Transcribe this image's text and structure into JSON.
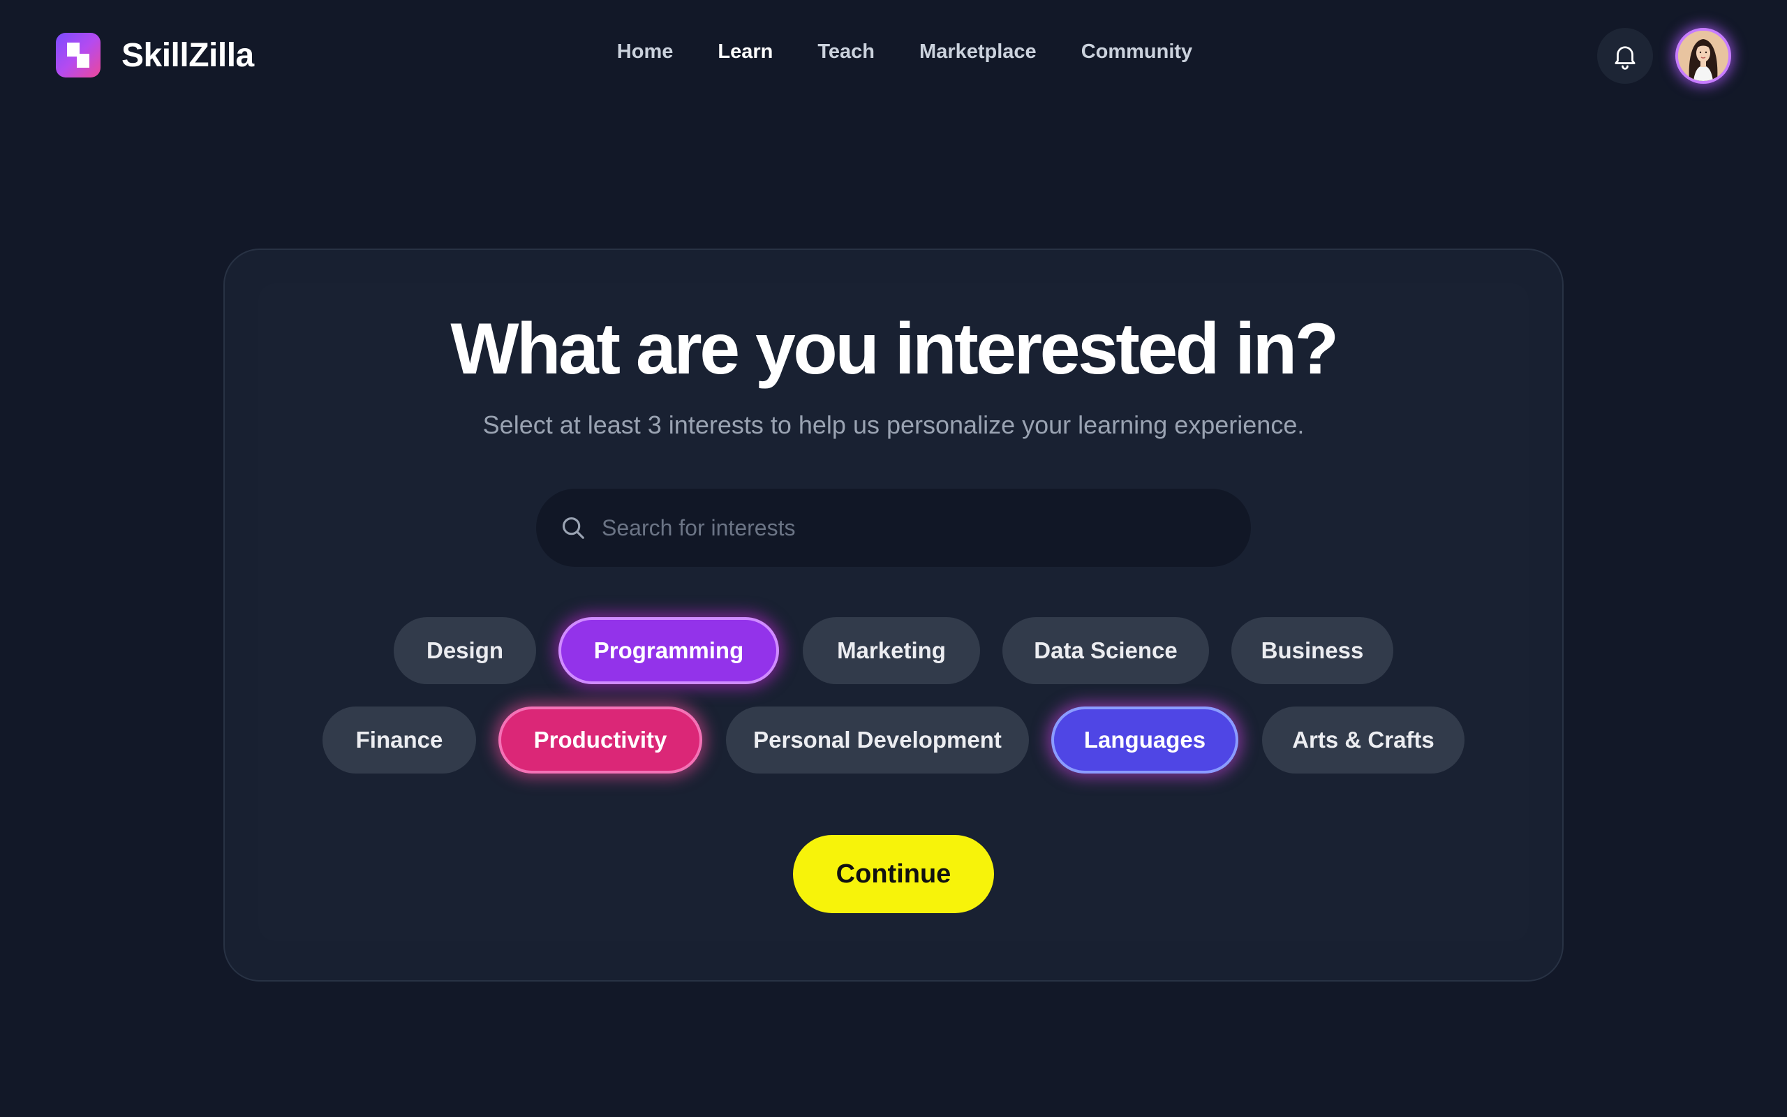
{
  "brand": {
    "name": "SkillZilla"
  },
  "nav": {
    "items": [
      {
        "label": "Home",
        "active": false
      },
      {
        "label": "Learn",
        "active": true
      },
      {
        "label": "Teach",
        "active": false
      },
      {
        "label": "Marketplace",
        "active": false
      },
      {
        "label": "Community",
        "active": false
      }
    ]
  },
  "header_actions": {
    "notifications_icon": "bell-icon",
    "avatar_icon": "user-avatar"
  },
  "onboarding": {
    "title": "What are you interested in?",
    "subtitle": "Select at least 3 interests to help us personalize your learning experience.",
    "search_placeholder": "Search for interests",
    "interests": [
      {
        "label": "Design",
        "selected": false
      },
      {
        "label": "Programming",
        "selected": true,
        "color": "#9333ea"
      },
      {
        "label": "Marketing",
        "selected": false
      },
      {
        "label": "Data Science",
        "selected": false
      },
      {
        "label": "Business",
        "selected": false
      },
      {
        "label": "Finance",
        "selected": false
      },
      {
        "label": "Productivity",
        "selected": true,
        "color": "#db2777"
      },
      {
        "label": "Personal Development",
        "selected": false
      },
      {
        "label": "Languages",
        "selected": true,
        "color": "#4f46e5"
      },
      {
        "label": "Arts & Crafts",
        "selected": false
      }
    ],
    "continue_label": "Continue"
  },
  "colors": {
    "background": "#121828",
    "card": "#182031",
    "chip": "#323b4b",
    "accent_yellow": "#f7f30a"
  }
}
